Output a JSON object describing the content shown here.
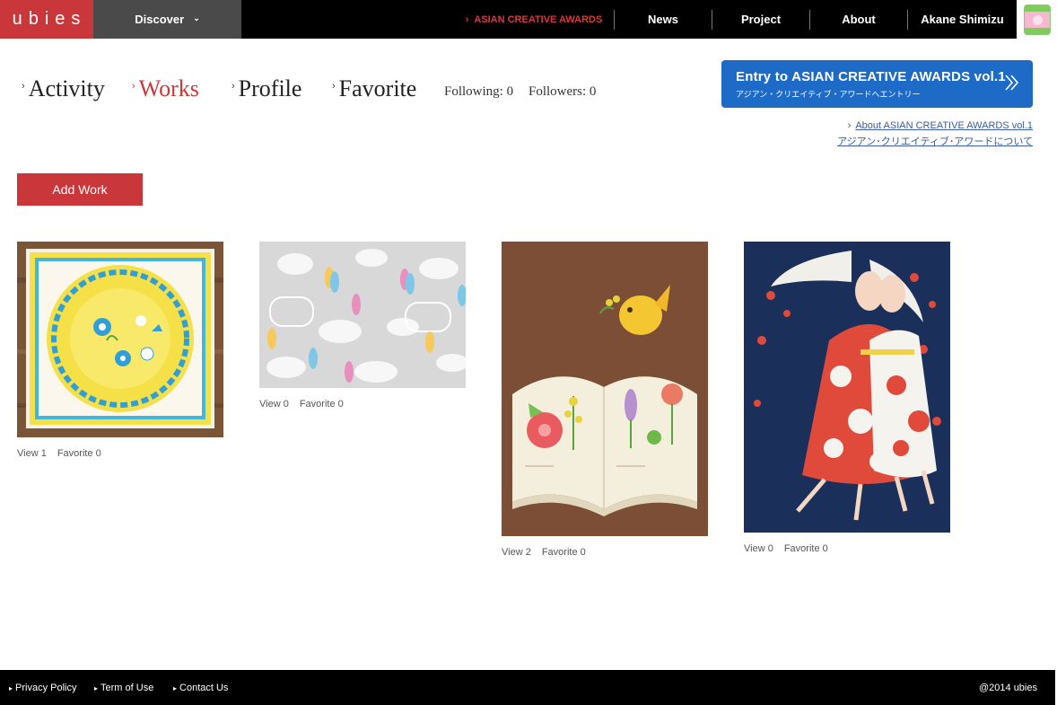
{
  "header": {
    "logo": "ubies",
    "discover_label": "Discover",
    "awards_label": "ASIAN CREATIVE AWARDS",
    "nav": [
      {
        "label": "News"
      },
      {
        "label": "Project"
      },
      {
        "label": "About"
      },
      {
        "label": "Akane Shimizu"
      }
    ]
  },
  "profile": {
    "tabs": [
      {
        "label": "Activity",
        "active": false
      },
      {
        "label": "Works",
        "active": true
      },
      {
        "label": "Profile",
        "active": false
      },
      {
        "label": "Favorite",
        "active": false
      }
    ],
    "following": "Following: 0",
    "followers": "Followers: 0"
  },
  "entry_banner": {
    "title": "Entry to ASIAN CREATIVE AWARDS vol.1",
    "subtitle": "アジアン・クリエイティブ・アワードへエントリー"
  },
  "about_link": {
    "line1": "About ASIAN CREATIVE AWARDS vol.1",
    "line2": "アジアン･クリエイティブ･アワードについて"
  },
  "add_work_label": "Add Work",
  "works": [
    {
      "view": "View 1",
      "favorite": "Favorite 0"
    },
    {
      "view": "View 0",
      "favorite": "Favorite 0"
    },
    {
      "view": "View 2",
      "favorite": "Favorite 0"
    },
    {
      "view": "View 0",
      "favorite": "Favorite 0"
    }
  ],
  "footer": {
    "links": [
      {
        "label": "Privacy Policy"
      },
      {
        "label": "Term of Use"
      },
      {
        "label": "Contact Us"
      }
    ],
    "copyright": "@2014 ubies"
  },
  "colors": {
    "brand_red": "#c9373a",
    "entry_blue": "#1d6bc6"
  }
}
